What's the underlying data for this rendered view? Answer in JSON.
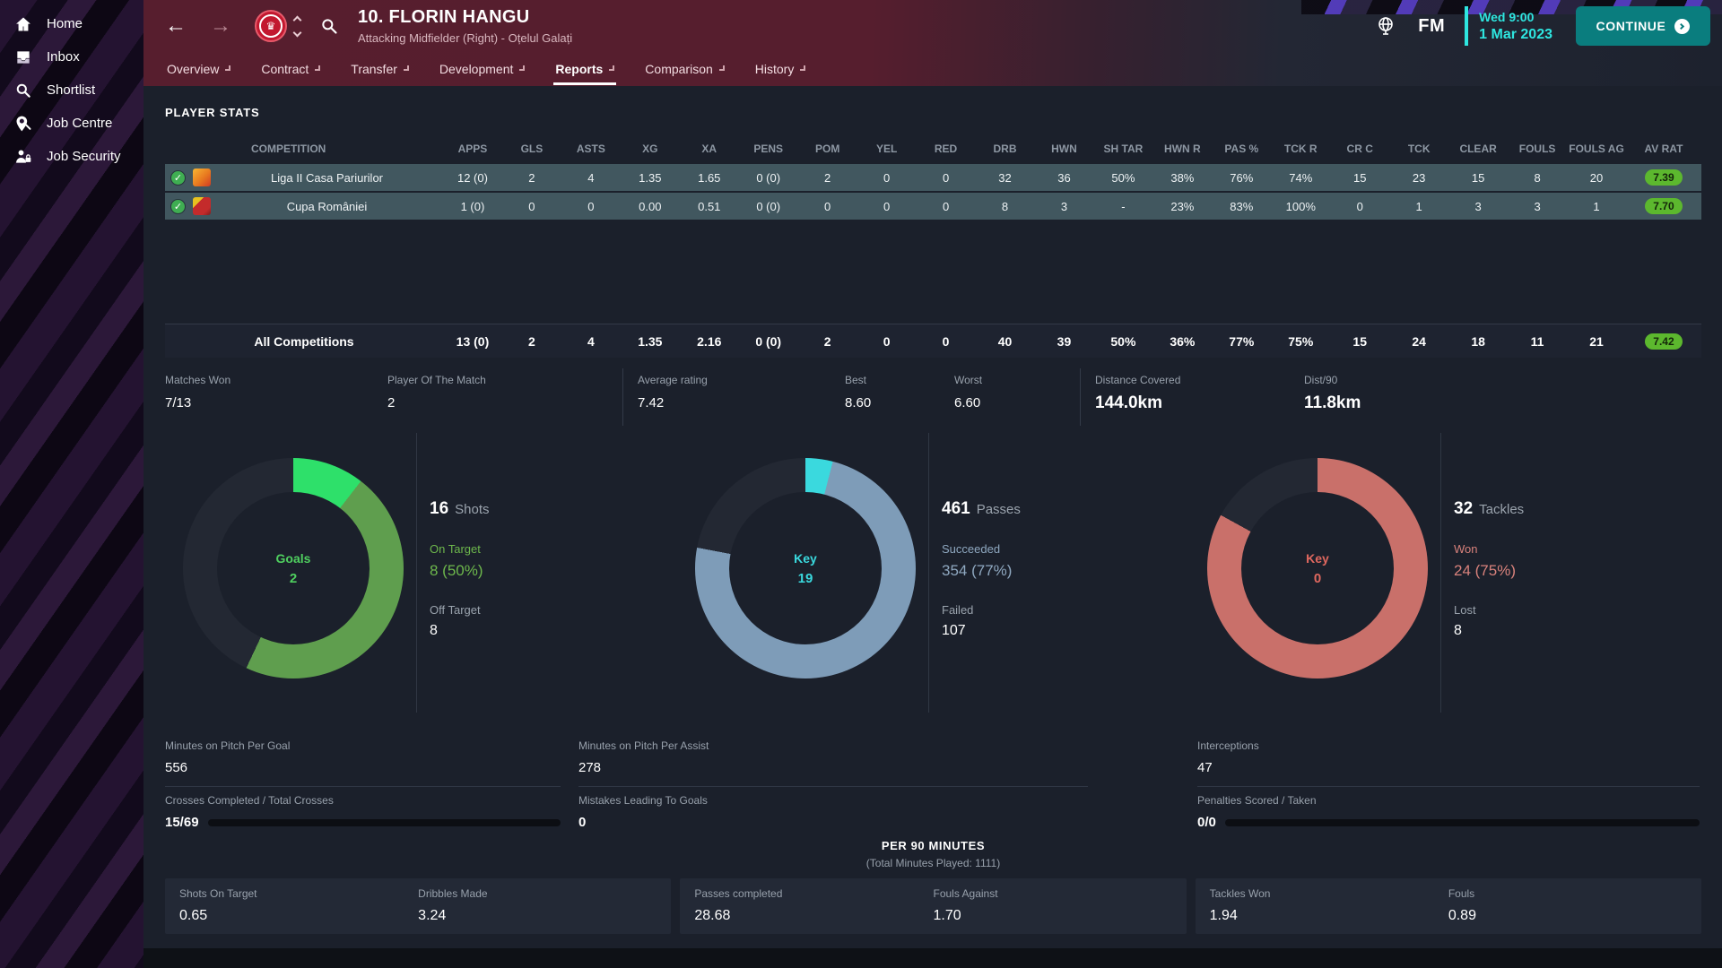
{
  "colors": {
    "accent_cyan": "#2ee6e0",
    "continue_teal": "#0a7d7e",
    "rating_green": "#5cb82e",
    "row_bg": "#41575f",
    "donut_track": "#232833"
  },
  "sidebar": {
    "items": [
      {
        "label": "Home",
        "icon": "home-icon"
      },
      {
        "label": "Inbox",
        "icon": "inbox-icon"
      },
      {
        "label": "Shortlist",
        "icon": "shortlist-icon"
      },
      {
        "label": "Job Centre",
        "icon": "job-centre-icon"
      },
      {
        "label": "Job Security",
        "icon": "job-security-icon"
      }
    ]
  },
  "topbar": {
    "player_title": "10. FLORIN HANGU",
    "player_subtitle": "Attacking Midfielder (Right) - Oțelul Galați",
    "fm_label": "FM",
    "clock_time": "Wed 9:00",
    "clock_date": "1 Mar 2023",
    "continue_label": "CONTINUE",
    "tabs": [
      {
        "label": "Overview",
        "active": false
      },
      {
        "label": "Contract",
        "active": false
      },
      {
        "label": "Transfer",
        "active": false
      },
      {
        "label": "Development",
        "active": false
      },
      {
        "label": "Reports",
        "active": true
      },
      {
        "label": "Comparison",
        "active": false
      },
      {
        "label": "History",
        "active": false
      }
    ]
  },
  "player_stats": {
    "section_title": "PLAYER STATS",
    "columns": [
      "COMPETITION",
      "APPS",
      "GLS",
      "ASTS",
      "XG",
      "XA",
      "PENS",
      "POM",
      "YEL",
      "RED",
      "DRB",
      "HWN",
      "SH TAR",
      "HWN R",
      "PAS %",
      "TCK R",
      "CR C",
      "TCK",
      "CLEAR",
      "FOULS",
      "FOULS AG",
      "AV RAT"
    ],
    "rows": [
      {
        "competition": "Liga II Casa Pariurilor",
        "values": [
          "12 (0)",
          "2",
          "4",
          "1.35",
          "1.65",
          "0 (0)",
          "2",
          "0",
          "0",
          "32",
          "36",
          "50%",
          "38%",
          "76%",
          "74%",
          "15",
          "23",
          "15",
          "8",
          "20"
        ],
        "rating": "7.39"
      },
      {
        "competition": "Cupa României",
        "values": [
          "1 (0)",
          "0",
          "0",
          "0.00",
          "0.51",
          "0 (0)",
          "0",
          "0",
          "0",
          "8",
          "3",
          "-",
          "23%",
          "83%",
          "100%",
          "0",
          "1",
          "3",
          "3",
          "1"
        ],
        "rating": "7.70"
      }
    ],
    "totals": {
      "label": "All Competitions",
      "values": [
        "13 (0)",
        "2",
        "4",
        "1.35",
        "2.16",
        "0 (0)",
        "2",
        "0",
        "0",
        "40",
        "39",
        "50%",
        "36%",
        "77%",
        "75%",
        "15",
        "24",
        "18",
        "11",
        "21"
      ],
      "rating": "7.42"
    }
  },
  "summary": {
    "cells": [
      {
        "label": "Matches Won",
        "value": "7/13",
        "size": "md",
        "divider": false
      },
      {
        "label": "Player Of The Match",
        "value": "2",
        "size": "md",
        "divider": false
      },
      {
        "label": "Average rating",
        "value": "7.42",
        "size": "md",
        "divider": true
      },
      {
        "label": "Best",
        "value": "8.60",
        "size": "md",
        "divider": false
      },
      {
        "label": "Worst",
        "value": "6.60",
        "size": "md",
        "divider": false
      },
      {
        "label": "Distance Covered",
        "value": "144.0km",
        "size": "lg",
        "divider": true
      },
      {
        "label": "Dist/90",
        "value": "11.8km",
        "size": "lg",
        "divider": false
      }
    ]
  },
  "chart_data": [
    {
      "type": "pie",
      "name": "goals-shots-donut",
      "center_label": "Goals",
      "center_value": "2",
      "center_color": "#4fcf5f",
      "segments": [
        {
          "label": "highlight",
          "color": "#2ee06a",
          "pct": 10.5
        },
        {
          "label": "main",
          "color": "#5f9e4e",
          "pct": 46.5
        },
        {
          "label": "remainder",
          "color": "#232833",
          "pct": 43
        }
      ],
      "stats": {
        "value": "16",
        "label": "Shots",
        "sub1_label": "On Target",
        "sub1_value": "8 (50%)",
        "sub1_color": "#6db74c",
        "sub2_label": "Off Target",
        "sub2_value": "8"
      }
    },
    {
      "type": "pie",
      "name": "key-passes-donut",
      "center_label": "Key",
      "center_value": "19",
      "center_color": "#3ad9de",
      "segments": [
        {
          "label": "key",
          "color": "#3ad9de",
          "pct": 4
        },
        {
          "label": "completed",
          "color": "#7e9cb8",
          "pct": 74
        },
        {
          "label": "remainder",
          "color": "#232833",
          "pct": 22
        }
      ],
      "stats": {
        "value": "461",
        "label": "Passes",
        "sub1_label": "Succeeded",
        "sub1_value": "354 (77%)",
        "sub1_color": "#8fa8c0",
        "sub2_label": "Failed",
        "sub2_value": "107"
      }
    },
    {
      "type": "pie",
      "name": "key-tackles-donut",
      "center_label": "Key",
      "center_value": "0",
      "center_color": "#e0685f",
      "segments": [
        {
          "label": "won",
          "color": "#c9706a",
          "pct": 83
        },
        {
          "label": "remainder",
          "color": "#232833",
          "pct": 17
        }
      ],
      "stats": {
        "value": "32",
        "label": "Tackles",
        "sub1_label": "Won",
        "sub1_value": "24 (75%)",
        "sub1_color": "#d9827c",
        "sub2_label": "Lost",
        "sub2_value": "8"
      }
    },
    {
      "type": "bar",
      "name": "crosses-progress",
      "value": 15,
      "total": 69,
      "pct": 21.7,
      "color": "#4fd8dc"
    },
    {
      "type": "bar",
      "name": "penalties-progress",
      "value": 0,
      "total": 0,
      "pct": 100,
      "color": "#4fd8dc"
    }
  ],
  "metrics": {
    "row_a": [
      {
        "label": "Minutes on Pitch Per Goal",
        "value": "556"
      },
      {
        "label": "Minutes on Pitch Per Assist",
        "value": "278"
      },
      {
        "label": "Interceptions",
        "value": "47"
      }
    ],
    "row_b": [
      {
        "label": "Crosses Completed / Total Crosses",
        "value": "15/69",
        "bar_pct": 21.7
      },
      {
        "label": "Mistakes Leading To Goals",
        "value": "0",
        "bar_pct": null
      },
      {
        "label": "Penalties Scored / Taken",
        "value": "0/0",
        "bar_pct": 100
      }
    ]
  },
  "per90": {
    "title": "PER 90 MINUTES",
    "subtitle": "(Total Minutes Played: 1111)",
    "cards": [
      [
        {
          "label": "Shots On Target",
          "value": "0.65"
        },
        {
          "label": "Dribbles Made",
          "value": "3.24"
        }
      ],
      [
        {
          "label": "Passes completed",
          "value": "28.68"
        },
        {
          "label": "Fouls Against",
          "value": "1.70"
        }
      ],
      [
        {
          "label": "Tackles Won",
          "value": "1.94"
        },
        {
          "label": "Fouls",
          "value": "0.89"
        }
      ]
    ]
  }
}
